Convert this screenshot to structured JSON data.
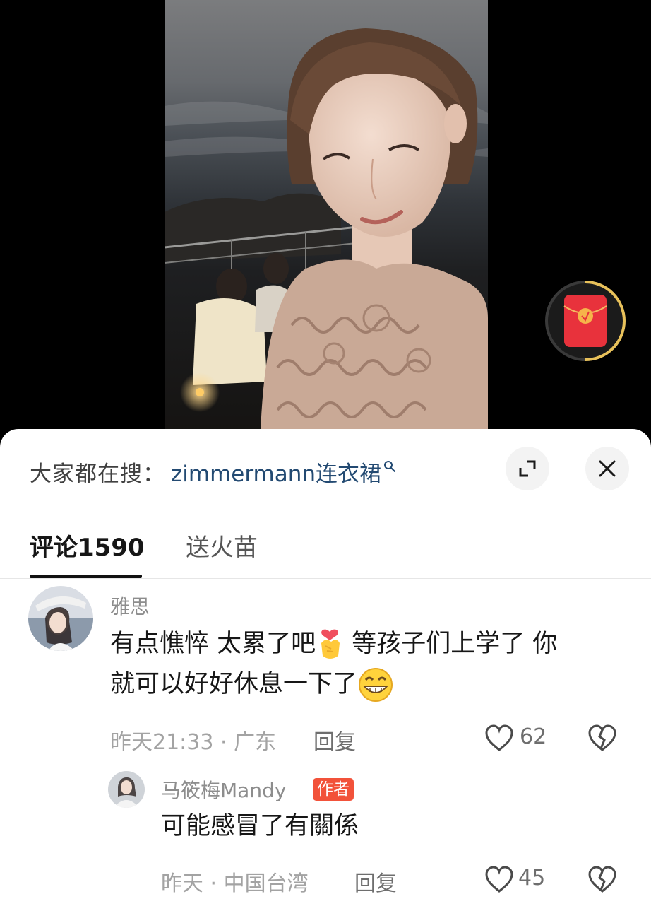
{
  "search": {
    "prefix": "大家都在搜：",
    "term": "zimmermann连衣裙"
  },
  "tabs": {
    "comments_label": "评论",
    "comments_count": "1590",
    "fire_label": "送火苗"
  },
  "comments": [
    {
      "username": "雅思",
      "text_part1": "有点憔悴 太累了吧",
      "text_part2": " 等孩子们上学了 你",
      "text_part3": "就可以好好休息一下了",
      "time": "昨天21:33",
      "location": "广东",
      "reply_label": "回复",
      "likes": "62"
    },
    {
      "username": "马筱梅Mandy",
      "badge": "作者",
      "text": "可能感冒了有關係",
      "time": "昨天",
      "location": "中国台湾",
      "reply_label": "回复",
      "likes": "45"
    }
  ],
  "icons": {
    "search_hint": "search-icon",
    "expand": "expand-icon",
    "close": "close-icon",
    "like": "heart-icon",
    "dislike": "broken-heart-icon",
    "red_packet": "red-packet-icon"
  },
  "colors": {
    "search_term": "#234a72",
    "author_badge": "#f2523a",
    "red_packet": "#e8323c",
    "ring": "#e8c15a"
  }
}
